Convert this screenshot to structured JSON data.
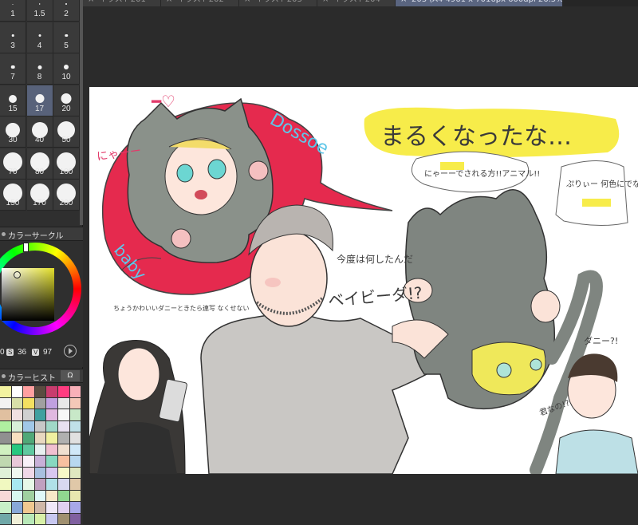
{
  "brush_sizes": {
    "items": [
      {
        "label": "1",
        "dot": 1
      },
      {
        "label": "1.5",
        "dot": 1.5
      },
      {
        "label": "2",
        "dot": 2
      },
      {
        "label": "3",
        "dot": 2.5
      },
      {
        "label": "4",
        "dot": 3
      },
      {
        "label": "5",
        "dot": 3.5
      },
      {
        "label": "7",
        "dot": 4.5
      },
      {
        "label": "8",
        "dot": 5
      },
      {
        "label": "10",
        "dot": 6
      },
      {
        "label": "15",
        "dot": 10
      },
      {
        "label": "17",
        "dot": 11,
        "selected": true
      },
      {
        "label": "20",
        "dot": 13
      },
      {
        "label": "30",
        "dot": 18
      },
      {
        "label": "40",
        "dot": 20
      },
      {
        "label": "50",
        "dot": 22
      },
      {
        "label": "70",
        "dot": 24
      },
      {
        "label": "80",
        "dot": 24
      },
      {
        "label": "100",
        "dot": 24
      },
      {
        "label": "150",
        "dot": 24
      },
      {
        "label": "170",
        "dot": 24
      },
      {
        "label": "200",
        "dot": 24
      }
    ]
  },
  "color_circle": {
    "title": "カラーサークル",
    "h_value": "0",
    "s_tag": "S",
    "s_value": "36",
    "v_tag": "V",
    "v_value": "97",
    "hue_color": "#e3df2a"
  },
  "color_history": {
    "title": "カラーヒスト",
    "tab2": "Ω",
    "swatches": [
      "#f2f2a0",
      "#ffffff",
      "#ffa0a0",
      "#5a4c40",
      "#c83c6e",
      "#ff3c80",
      "#f8b0b8",
      "#f2f2f2",
      "#d8e0a8",
      "#f4e060",
      "#a0a0a0",
      "#c0a0e0",
      "#e8e8e8",
      "#f4c8b8",
      "#e0c0a0",
      "#f0e0e0",
      "#d0d0d0",
      "#40a0a0",
      "#e0b8e0",
      "#f8f8f8",
      "#c8e8c8",
      "#b0f0a0",
      "#d8f0d8",
      "#a0c8e8",
      "#c8c8c8",
      "#a0d8c8",
      "#e8e0f0",
      "#c0e0e8",
      "#909090",
      "#f8e0c0",
      "#50a878",
      "#e8d8c0",
      "#f0f0a0",
      "#b0b0b0",
      "#e0e0e0",
      "#d0f0c0",
      "#28c880",
      "#60c8a0",
      "#e8f0f0",
      "#f0c0d0",
      "#f0e0d0",
      "#d0e8f8",
      "#c0d8b0",
      "#e8c8d8",
      "#f8f0f8",
      "#c8b0d8",
      "#88d8c0",
      "#f8c0a0",
      "#b8d8f0",
      "#e0f0d8",
      "#f0f8f0",
      "#f0d8e8",
      "#a8c0e0",
      "#d8c8f0",
      "#f8f8c8",
      "#e0e8c0",
      "#f0f8c0",
      "#a8e8f0",
      "#e8f8e8",
      "#c0a0c0",
      "#b0e0e8",
      "#d8d8f0",
      "#e0c8a8",
      "#f8d8d8",
      "#d8f8f0",
      "#a0d0a0",
      "#e0f8f8",
      "#f8e8c8",
      "#90d890",
      "#e8e8b0",
      "#c8f0c8",
      "#88a8d8",
      "#f0c890",
      "#d0b8a8",
      "#f0e8f8",
      "#e0d0f0",
      "#a8a8e8",
      "#70a8a8",
      "#f0f0d8",
      "#b8e8b8",
      "#d8f0a8",
      "#c8c8f0",
      "#a09070",
      "#8060a0",
      "#e8f0a0",
      "#a8c8c8",
      "#d8a880",
      "#f0d8b0",
      "#c0e0c0",
      "#b8a8d8",
      "#90b070",
      "#d0e0a0",
      "#e0f0f8",
      "#e8d090",
      "#f8f8a8",
      "#b0c8f0",
      "#e8a8c8",
      "#1a28ff"
    ]
  },
  "tabs": [
    {
      "label": "イラスト201"
    },
    {
      "label": "イラスト202"
    },
    {
      "label": "イラスト203"
    },
    {
      "label": "イラスト204"
    },
    {
      "label": "203 (A4 4961 x 7016px 600dpi 26.5%)",
      "active": true
    }
  ],
  "canvas": {
    "text_main": "まるくなったな…",
    "text_nyaa": "にゃーー",
    "text_name1": "Dossoe",
    "text_name2": "baby",
    "text_bubble1": "にゃーーでされる方!!アニマル!!",
    "text_bubble2": "ぷりぃー 何色にでなさい",
    "text_question": "今度は何したんだ",
    "text_baby": "ベイビーダ!?",
    "text_left_note": "ちょうかわいいダニーときたら連写 なくせない",
    "text_danny": "ダニー?!",
    "text_kimi": "君なの!?"
  }
}
